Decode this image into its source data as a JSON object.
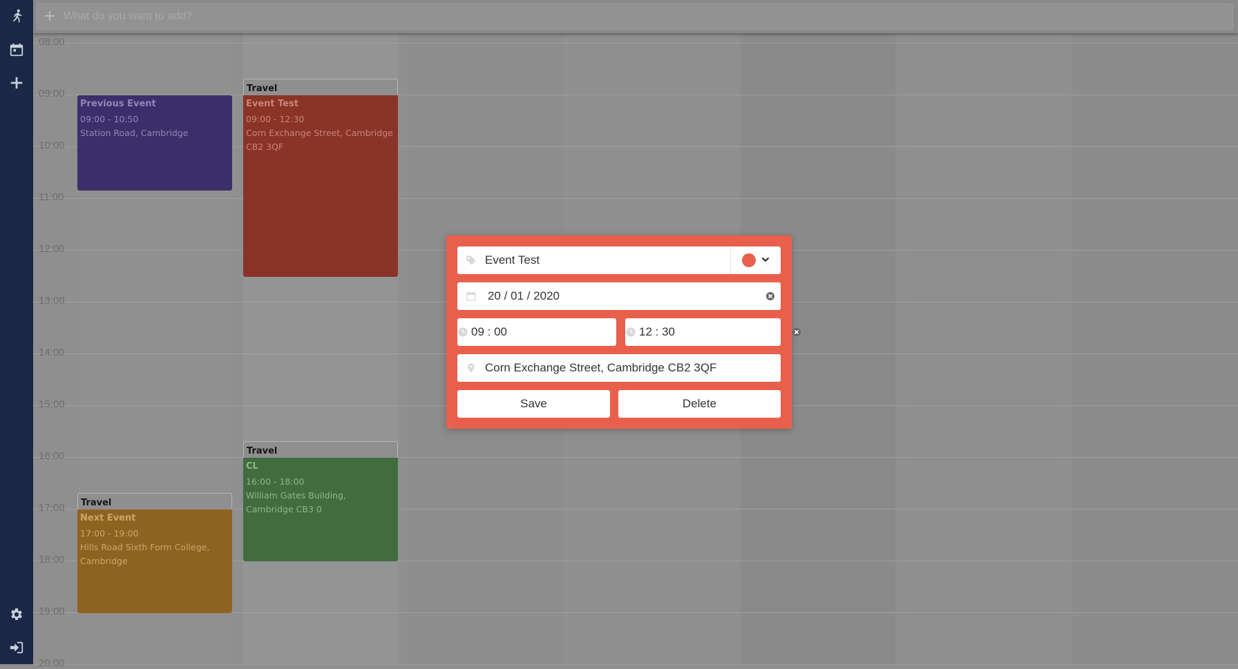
{
  "sidebar": {
    "items": [
      {
        "icon": "running-person-icon",
        "label": ""
      },
      {
        "icon": "calendar-icon",
        "label": ""
      },
      {
        "icon": "plus-icon",
        "label": ""
      }
    ],
    "bottom_items": [
      {
        "icon": "gear-icon"
      },
      {
        "icon": "logout-icon"
      }
    ]
  },
  "add_bar": {
    "placeholder": "What do you want to add?"
  },
  "calendar": {
    "hours": [
      "08:00",
      "09:00",
      "10:00",
      "11:00",
      "12:00",
      "13:00",
      "14:00",
      "15:00",
      "16:00",
      "17:00",
      "18:00",
      "19:00",
      "20:00"
    ],
    "events": [
      {
        "title": "Previous Event",
        "time": "09:00 - 10:50",
        "location": "Station Road, Cambridge",
        "color": "#3b2f6b"
      },
      {
        "title": "Event Test",
        "time": "09:00 - 12:30",
        "location": "Corn Exchange Street, Cambridge CB2 3QF",
        "color": "#8a3327",
        "travel": "Travel"
      },
      {
        "title": "CL",
        "time": "16:00 - 18:00",
        "location": "William Gates Building, Cambridge CB3 0",
        "color": "#416c3e",
        "travel": "Travel"
      },
      {
        "title": "Next Event",
        "time": "17:00 - 19:00",
        "location": "Hills Road Sixth Form College, Cambridge",
        "color": "#8e6321",
        "travel": "Travel"
      }
    ]
  },
  "modal": {
    "accent": "#e8604c",
    "title_value": "Event Test",
    "color_value": "#e8604c",
    "date_value": "20 / 01 / 2020",
    "start_time": "09 : 00",
    "end_time": "12 : 30",
    "location_value": "Corn Exchange Street, Cambridge CB2 3QF",
    "save_label": "Save",
    "delete_label": "Delete"
  }
}
